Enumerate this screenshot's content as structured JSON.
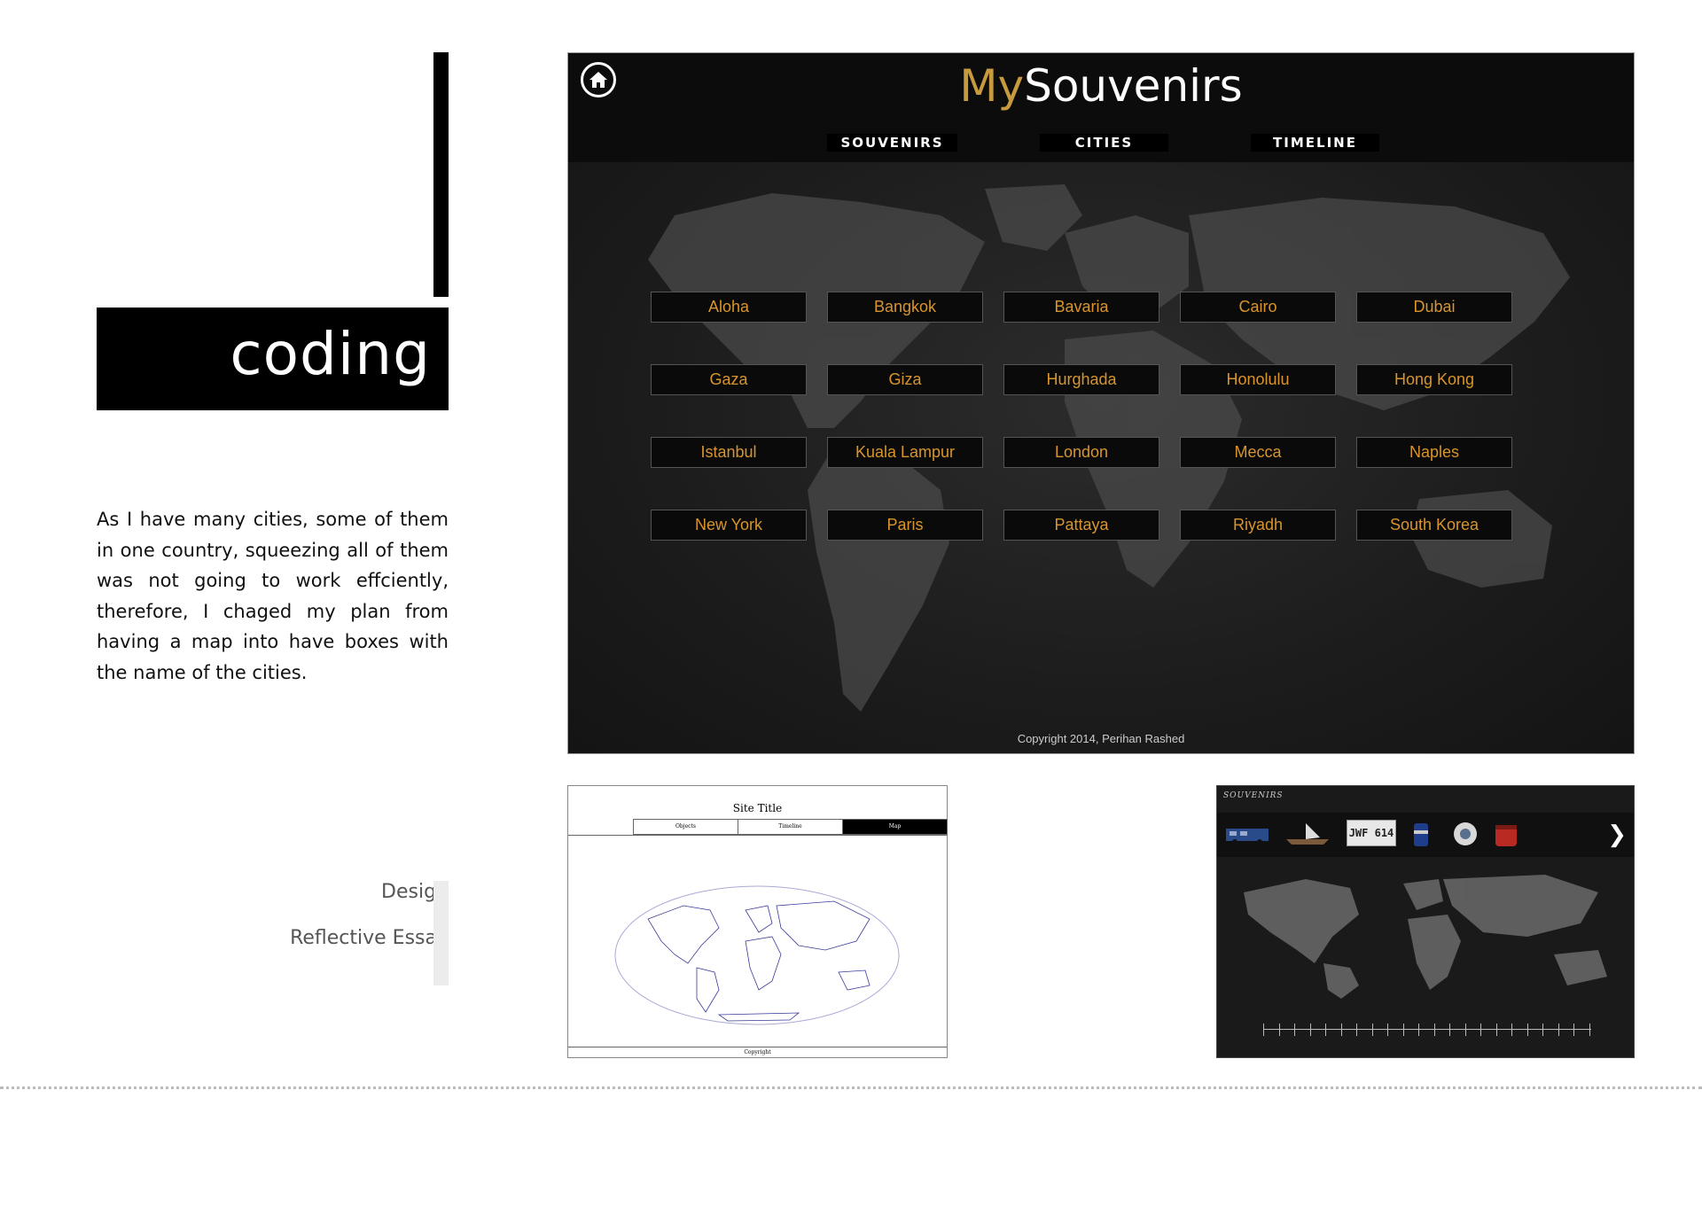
{
  "page": {
    "heading": "coding",
    "paragraph": "As I have many cities, some of them in one country, squeezing all of them was not going to work effciently, therefore, I chaged my plan from having a map into have boxes with the name of the cities.",
    "side_links": [
      "Design",
      "Reflective Essay"
    ]
  },
  "app": {
    "brand_my": "My",
    "brand_rest": "Souvenirs",
    "nav": [
      "SOUVENIRS",
      "CITIES",
      "TIMELINE"
    ],
    "cities": [
      "Aloha",
      "Bangkok",
      "Bavaria",
      "Cairo",
      "Dubai",
      "Gaza",
      "Giza",
      "Hurghada",
      "Honolulu",
      "Hong Kong",
      "Istanbul",
      "Kuala Lampur",
      "London",
      "Mecca",
      "Naples",
      "New York",
      "Paris",
      "Pattaya",
      "Riyadh",
      "South Korea"
    ],
    "copyright": "Copyright 2014, Perihan Rashed",
    "accent_color": "#c79a3e",
    "city_text_color": "#d9952b"
  },
  "wireframe": {
    "title": "Site Title",
    "tabs": [
      "Objects",
      "Timeline",
      "Map"
    ],
    "footer": "Copyright"
  },
  "thumbnail": {
    "title": "SOUVENIRS",
    "plate": "JWF 614",
    "next_icon": "chevron-right-icon"
  }
}
